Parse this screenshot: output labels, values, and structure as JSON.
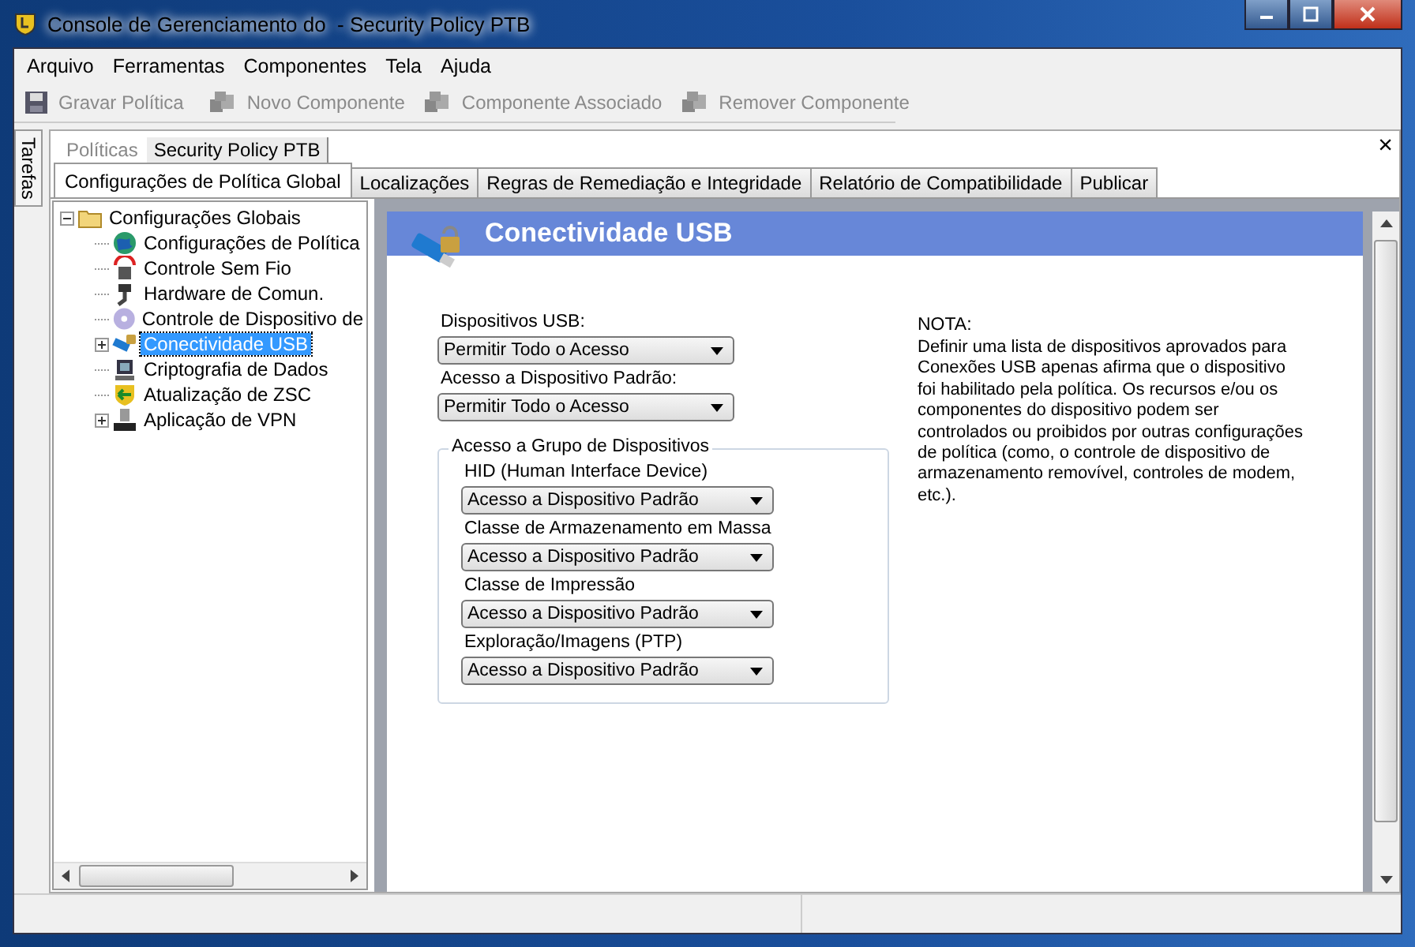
{
  "window": {
    "title": "Console de Gerenciamento do  - Security Policy PTB"
  },
  "menu": [
    "Arquivo",
    "Ferramentas",
    "Componentes",
    "Tela",
    "Ajuda"
  ],
  "toolbar": [
    {
      "label": "Gravar Política",
      "disabled": true
    },
    {
      "label": "Novo Componente",
      "disabled": true
    },
    {
      "label": "Componente Associado",
      "disabled": true
    },
    {
      "label": "Remover Componente",
      "disabled": true
    }
  ],
  "side_tab": "Tarefas",
  "breadcrumb": [
    {
      "label": "Políticas",
      "selected": false
    },
    {
      "label": "Security Policy PTB",
      "selected": true
    }
  ],
  "close_symbol": "×",
  "tabs": [
    {
      "label": "Configurações de Política Global",
      "selected": true
    },
    {
      "label": "Localizações",
      "selected": false
    },
    {
      "label": "Regras de Remediação e Integridade",
      "selected": false
    },
    {
      "label": "Relatório de Compatibilidade",
      "selected": false
    },
    {
      "label": "Publicar",
      "selected": false
    }
  ],
  "tree": [
    {
      "label": "Configurações Globais",
      "expanded": true,
      "selected": false,
      "children": [
        {
          "label": "Configurações de Política",
          "selected": false
        },
        {
          "label": "Controle Sem Fio",
          "selected": false
        },
        {
          "label": "Hardware de Comun.",
          "selected": false
        },
        {
          "label": "Controle de Dispositivo de",
          "selected": false
        },
        {
          "label": "Conectividade USB",
          "expanded": false,
          "selected": true
        },
        {
          "label": "Criptografia de Dados",
          "selected": false
        },
        {
          "label": "Atualização de ZSC",
          "selected": false
        },
        {
          "label": "Aplicação de VPN",
          "expanded": false,
          "selected": false
        }
      ]
    }
  ],
  "panel": {
    "title": "Conectividade USB",
    "fields": [
      {
        "label": "Dispositivos USB:",
        "value": "Permitir Todo o Acesso"
      },
      {
        "label": "Acesso a Dispositivo Padrão:",
        "value": "Permitir Todo o Acesso"
      }
    ],
    "group": {
      "title": "Acesso a Grupo de Dispositivos",
      "fields": [
        {
          "label": "HID (Human Interface Device)",
          "value": "Acesso a Dispositivo Padrão"
        },
        {
          "label": "Classe de Armazenamento em Massa",
          "value": "Acesso a Dispositivo Padrão"
        },
        {
          "label": "Classe de Impressão",
          "value": "Acesso a Dispositivo Padrão"
        },
        {
          "label": "Exploração/Imagens (PTP)",
          "value": "Acesso a Dispositivo Padrão"
        }
      ]
    },
    "note": {
      "title": "NOTA:",
      "text": "Definir uma lista de dispositivos aprovados para Conexões USB apenas afirma que o dispositivo foi habilitado pela política.  Os recursos e/ou os componentes do dispositivo podem ser controlados ou proibidos por outras configurações de política (como, o controle de dispositivo de armazenamento removível, controles de modem, etc.)."
    }
  }
}
